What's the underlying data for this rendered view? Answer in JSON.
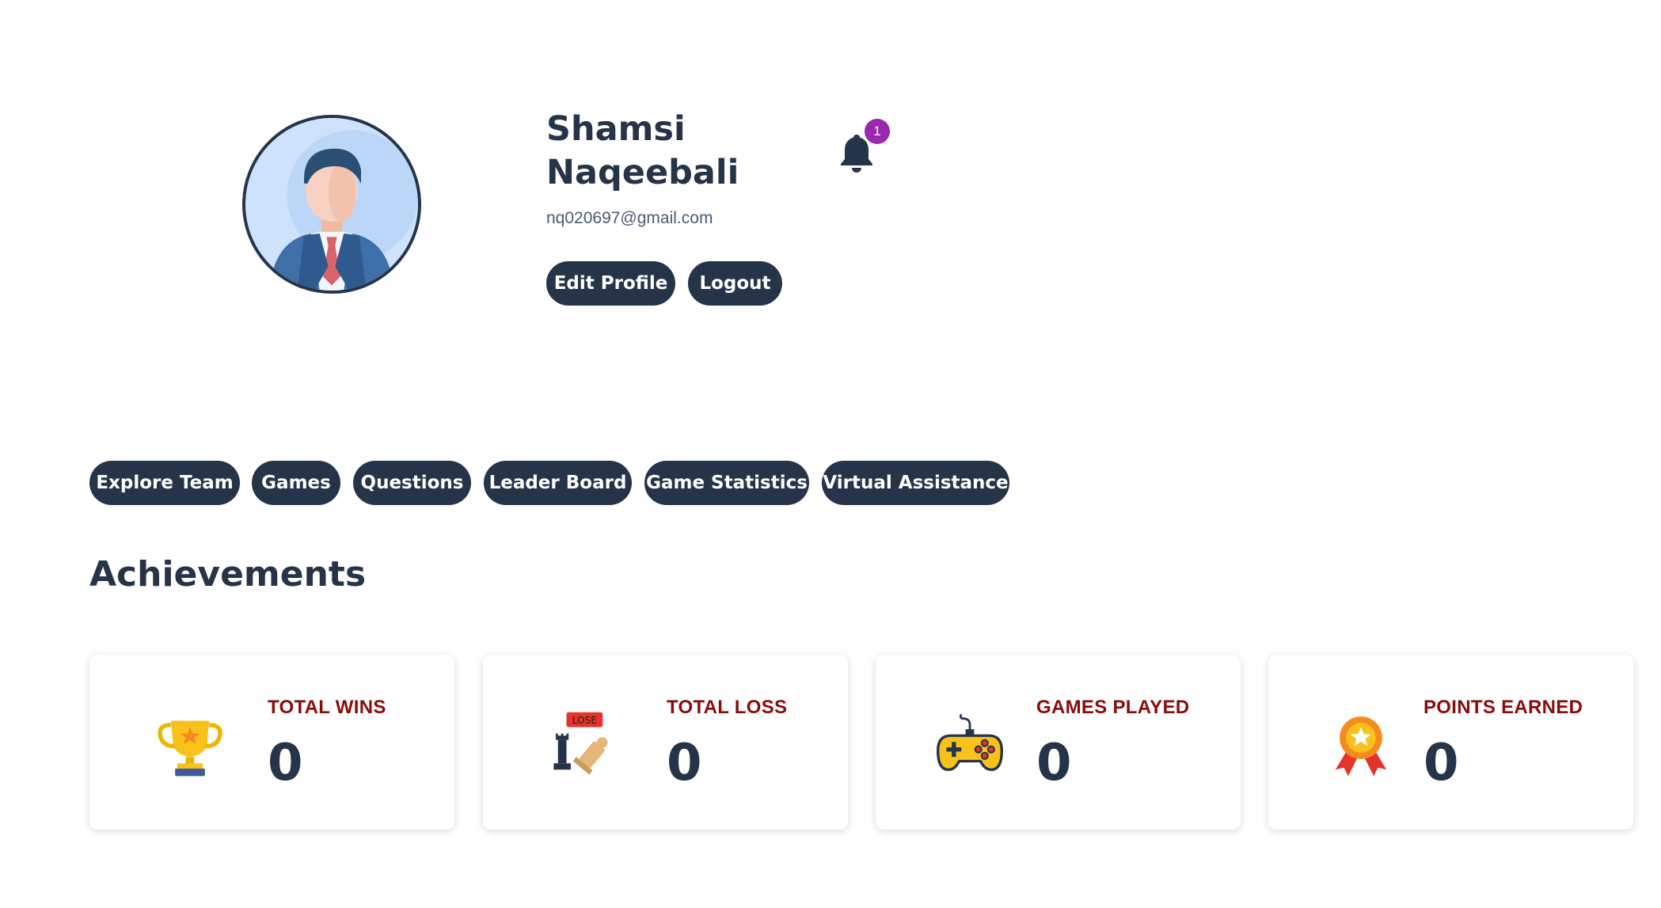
{
  "profile": {
    "first_name": "Shamsi",
    "last_name": "Naqeebali",
    "email": "nq020697@gmail.com",
    "edit_label": "Edit Profile",
    "logout_label": "Logout",
    "notification_count": "1"
  },
  "nav": {
    "items": [
      {
        "label": "Explore Team"
      },
      {
        "label": "Games"
      },
      {
        "label": "Questions"
      },
      {
        "label": "Leader Board"
      },
      {
        "label": "Game Statistics"
      },
      {
        "label": "Virtual Assistance"
      }
    ]
  },
  "achievements": {
    "title": "Achievements",
    "stats": [
      {
        "label": "TOTAL WINS",
        "value": "0",
        "icon": "trophy-icon"
      },
      {
        "label": "TOTAL LOSS",
        "value": "0",
        "icon": "chess-lose-icon"
      },
      {
        "label": "GAMES PLAYED",
        "value": "0",
        "icon": "gamepad-icon"
      },
      {
        "label": "POINTS EARNED",
        "value": "0",
        "icon": "medal-icon"
      }
    ]
  },
  "colors": {
    "primary": "#263449",
    "stat_label": "#8b0a0a",
    "badge": "#9b27b0"
  }
}
